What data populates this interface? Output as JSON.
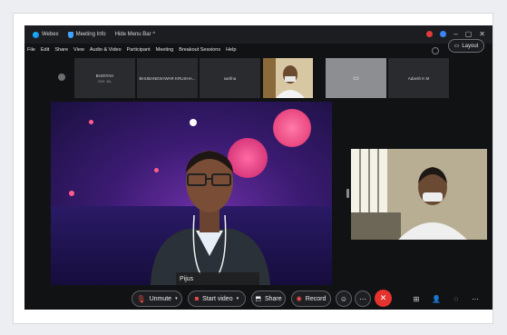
{
  "window": {
    "app_name": "Webex",
    "meeting_info": "Meeting Info",
    "hide_menu": "Hide Menu Bar ^"
  },
  "menu": [
    "File",
    "Edit",
    "Share",
    "View",
    "Audio & Video",
    "Participant",
    "Meeting",
    "Breakout Sessions",
    "Help"
  ],
  "thumbnails": [
    {
      "name": "BHOITAH",
      "sub": "VIVE. BA."
    },
    {
      "name": "BHUBANESHWAR KRUSHA...",
      "sub": ""
    },
    {
      "name": "sarifna",
      "sub": ""
    },
    {
      "name": "",
      "sub": ""
    },
    {
      "name": "",
      "sub": ""
    },
    {
      "name": "Adarsh K M",
      "sub": ""
    }
  ],
  "layout_button": "Layout",
  "speaker": {
    "name": "Pijus"
  },
  "controls": {
    "unmute": "Unmute",
    "start_video": "Start video",
    "share": "Share",
    "record": "Record"
  },
  "colors": {
    "app_bg": "#111214",
    "leave_red": "#e5332f",
    "accent_blue": "#3b84ff"
  }
}
